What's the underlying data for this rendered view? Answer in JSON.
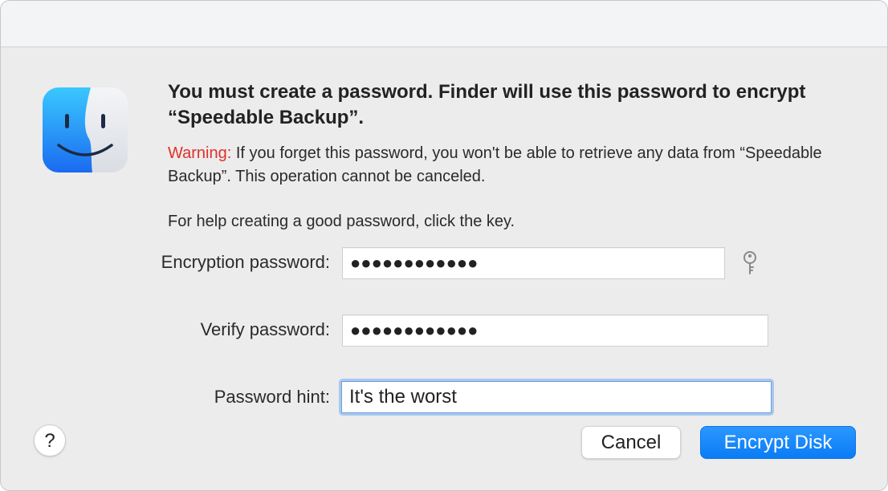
{
  "dialog": {
    "headline": "You must create a password. Finder will use this password to encrypt “Speedable Backup”.",
    "warning_label": "Warning:",
    "warning_body": " If you forget this password, you won't be able to retrieve any data from “Speedable Backup”. This operation cannot be canceled.",
    "help_text": "For help creating a good password, click the key.",
    "icon": "finder-icon"
  },
  "fields": {
    "encryption_password": {
      "label": "Encryption password:",
      "value": "●●●●●●●●●●●●"
    },
    "verify_password": {
      "label": "Verify password:",
      "value": "●●●●●●●●●●●●"
    },
    "password_hint": {
      "label": "Password hint:",
      "value": "It's the worst"
    }
  },
  "buttons": {
    "help": "?",
    "cancel": "Cancel",
    "encrypt": "Encrypt Disk"
  },
  "icons": {
    "key": "key-icon",
    "help": "question-mark-icon"
  },
  "colors": {
    "accent": "#0a7cf5",
    "warning": "#e0302a",
    "focus_ring": "#a9c8ef"
  }
}
